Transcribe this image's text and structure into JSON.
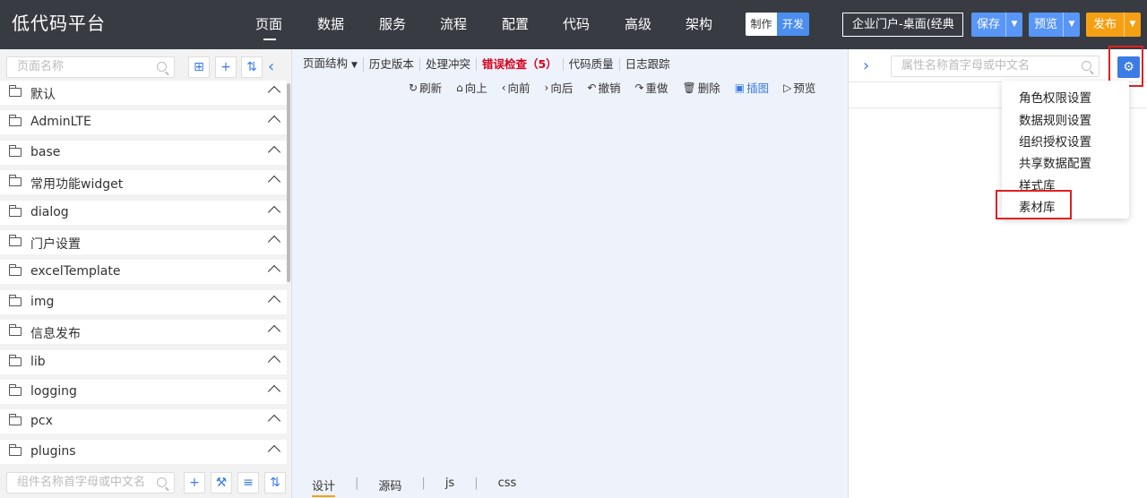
{
  "app": {
    "logo": "低代码平台"
  },
  "nav": [
    {
      "label": "页面"
    },
    {
      "label": "数据"
    },
    {
      "label": "服务"
    },
    {
      "label": "流程"
    },
    {
      "label": "配置"
    },
    {
      "label": "代码"
    },
    {
      "label": "高级"
    },
    {
      "label": "架构"
    }
  ],
  "mode": {
    "make": "制作",
    "dev": "开发"
  },
  "header": {
    "portal": "企业门户-桌面(经典",
    "save": "保存",
    "preview": "预览",
    "publish": "发布"
  },
  "left": {
    "search_placeholder": "页面名称",
    "tree": [
      {
        "label": "默认"
      },
      {
        "label": "AdminLTE"
      },
      {
        "label": "base"
      },
      {
        "label": "常用功能widget"
      },
      {
        "label": "dialog"
      },
      {
        "label": "门户设置"
      },
      {
        "label": "excelTemplate"
      },
      {
        "label": "img"
      },
      {
        "label": "信息发布"
      },
      {
        "label": "lib"
      },
      {
        "label": "logging"
      },
      {
        "label": "pcx"
      },
      {
        "label": "plugins"
      }
    ],
    "component_search_placeholder": "组件名称首字母或中文名"
  },
  "center": {
    "tabs": [
      {
        "label": "页面结构"
      },
      {
        "label": "历史版本"
      },
      {
        "label": "处理冲突"
      },
      {
        "label": "错误检查（5）"
      },
      {
        "label": "代码质量"
      },
      {
        "label": "日志跟踪"
      }
    ],
    "tools": [
      {
        "label": "刷新"
      },
      {
        "label": "向上"
      },
      {
        "label": "向前"
      },
      {
        "label": "向后"
      },
      {
        "label": "撤销"
      },
      {
        "label": "重做"
      },
      {
        "label": "删除"
      },
      {
        "label": "插图"
      },
      {
        "label": "预览"
      }
    ],
    "bottom_tabs": [
      {
        "label": "设计"
      },
      {
        "label": "源码"
      },
      {
        "label": "js"
      },
      {
        "label": "css"
      }
    ]
  },
  "right": {
    "search_placeholder": "属性名称首字母或中文名",
    "menu": [
      {
        "label": "角色权限设置"
      },
      {
        "label": "数据规则设置"
      },
      {
        "label": "组织授权设置"
      },
      {
        "label": "共享数据配置"
      },
      {
        "label": "样式库"
      },
      {
        "label": "素材库"
      }
    ]
  },
  "colors": {
    "topbar": "#383c42",
    "accent": "#3a7be6",
    "orange": "#f5a014",
    "error": "#d9001b",
    "highlight": "#e02020"
  }
}
